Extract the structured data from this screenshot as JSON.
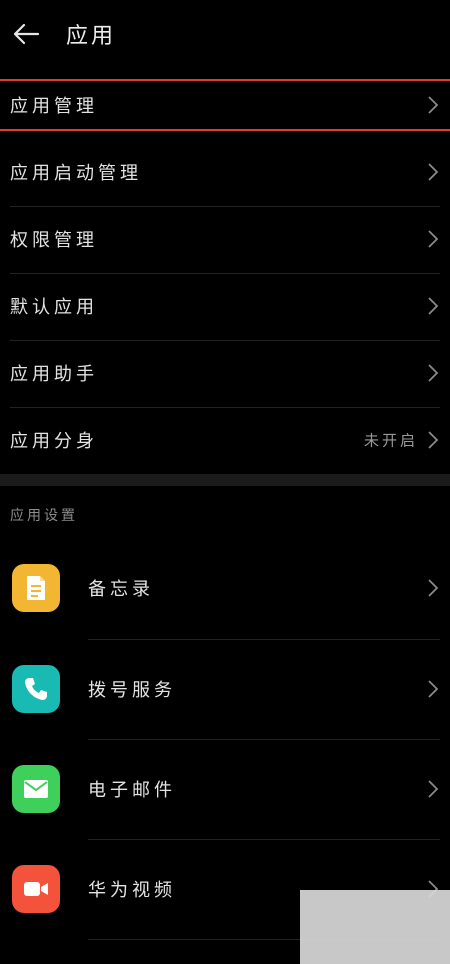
{
  "header": {
    "title": "应用",
    "back_icon": "arrow-left-icon"
  },
  "menu": [
    {
      "label": "应用管理",
      "value": "",
      "highlighted": true
    },
    {
      "label": "应用启动管理",
      "value": ""
    },
    {
      "label": "权限管理",
      "value": ""
    },
    {
      "label": "默认应用",
      "value": ""
    },
    {
      "label": "应用助手",
      "value": ""
    },
    {
      "label": "应用分身",
      "value": "未开启"
    }
  ],
  "section": {
    "title": "应用设置"
  },
  "apps": [
    {
      "label": "备忘录",
      "icon": "notepad-icon",
      "color": "#f2b632"
    },
    {
      "label": "拨号服务",
      "icon": "phone-icon",
      "color": "#19b9b4"
    },
    {
      "label": "电子邮件",
      "icon": "mail-icon",
      "color": "#3fcf5b"
    },
    {
      "label": "华为视频",
      "icon": "video-camera-icon",
      "color": "#f2533a"
    }
  ],
  "colors": {
    "highlight": "#e23a2f",
    "background": "#000000"
  }
}
